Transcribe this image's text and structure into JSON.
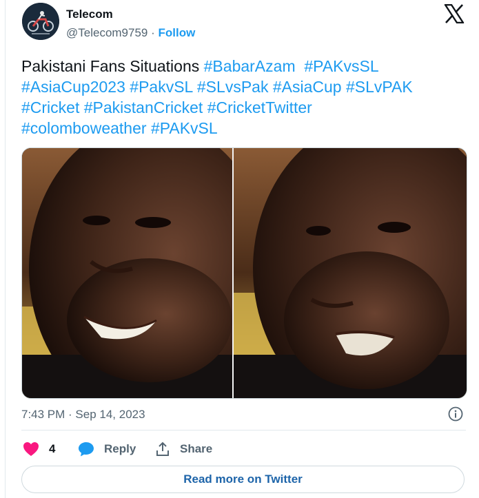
{
  "author": {
    "name": "Telecom",
    "handle": "@Telecom9759",
    "separator": " · ",
    "follow_label": "Follow"
  },
  "tweet": {
    "text_plain": "Pakistani Fans Situations",
    "hashtags": [
      "#BabarAzam",
      "#PAKvsSL",
      "#AsiaCup2023",
      "#PakvSL",
      "#SLvsPak",
      "#AsiaCup",
      "#SLvPAK",
      "#Cricket",
      "#PakistanCricket",
      "#CricketTwitter",
      "#colomboweather",
      "#PAKvSL"
    ]
  },
  "media": {
    "description_icons": [
      "left-face-smiling",
      "right-face-disappointed"
    ]
  },
  "meta": {
    "timestamp": "7:43 PM · Sep 14, 2023"
  },
  "actions": {
    "like_count": "4",
    "reply_label": "Reply",
    "share_label": "Share"
  },
  "read_more_label": "Read more on Twitter",
  "colors": {
    "link": "#1d9bf0",
    "heart": "#f91880",
    "reply_bubble": "#1d9bf0",
    "muted": "#536471"
  },
  "icons": [
    "x-logo-icon",
    "info-icon",
    "heart-icon",
    "reply-bubble-icon",
    "share-icon"
  ]
}
